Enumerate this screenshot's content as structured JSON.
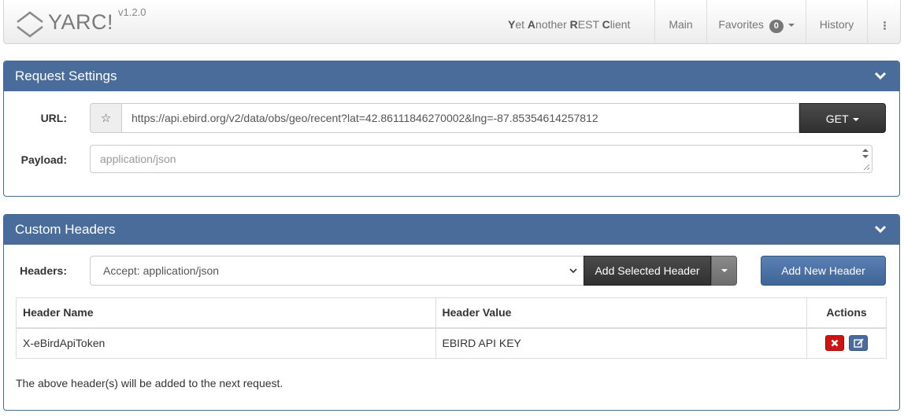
{
  "navbar": {
    "brand": "YARC!",
    "version": "v1.2.0",
    "tagline_parts": [
      {
        "bold": "Y",
        "rest": "et "
      },
      {
        "bold": "A",
        "rest": "nother "
      },
      {
        "bold": "R",
        "rest": "EST "
      },
      {
        "bold": "C",
        "rest": "lient"
      }
    ],
    "items": {
      "main": "Main",
      "favorites": "Favorites",
      "favorites_count": "0",
      "history": "History"
    },
    "icons": {
      "logo": "double-chevron-logo",
      "more": "vertical-dots-icon"
    }
  },
  "request_settings": {
    "title": "Request Settings",
    "url_label": "URL:",
    "url_value": "https://api.ebird.org/v2/data/obs/geo/recent?lat=42.86111846270002&lng=-87.85354614257812",
    "method": "GET",
    "payload_label": "Payload:",
    "payload_placeholder": "application/json"
  },
  "custom_headers": {
    "title": "Custom Headers",
    "headers_label": "Headers:",
    "selected_header": "Accept: application/json",
    "add_selected_label": "Add Selected Header",
    "add_new_label": "Add New Header",
    "columns": [
      "Header Name",
      "Header Value",
      "Actions"
    ],
    "rows": [
      {
        "name": "X-eBirdApiToken",
        "value": "EBIRD API KEY"
      }
    ],
    "note": "The above header(s) will be added to the next request."
  },
  "colors": {
    "panel_header": "#4a6c9a",
    "dark_button": "#3a3a3a",
    "primary_button": "#4a72a8",
    "danger": "#cc1414"
  }
}
